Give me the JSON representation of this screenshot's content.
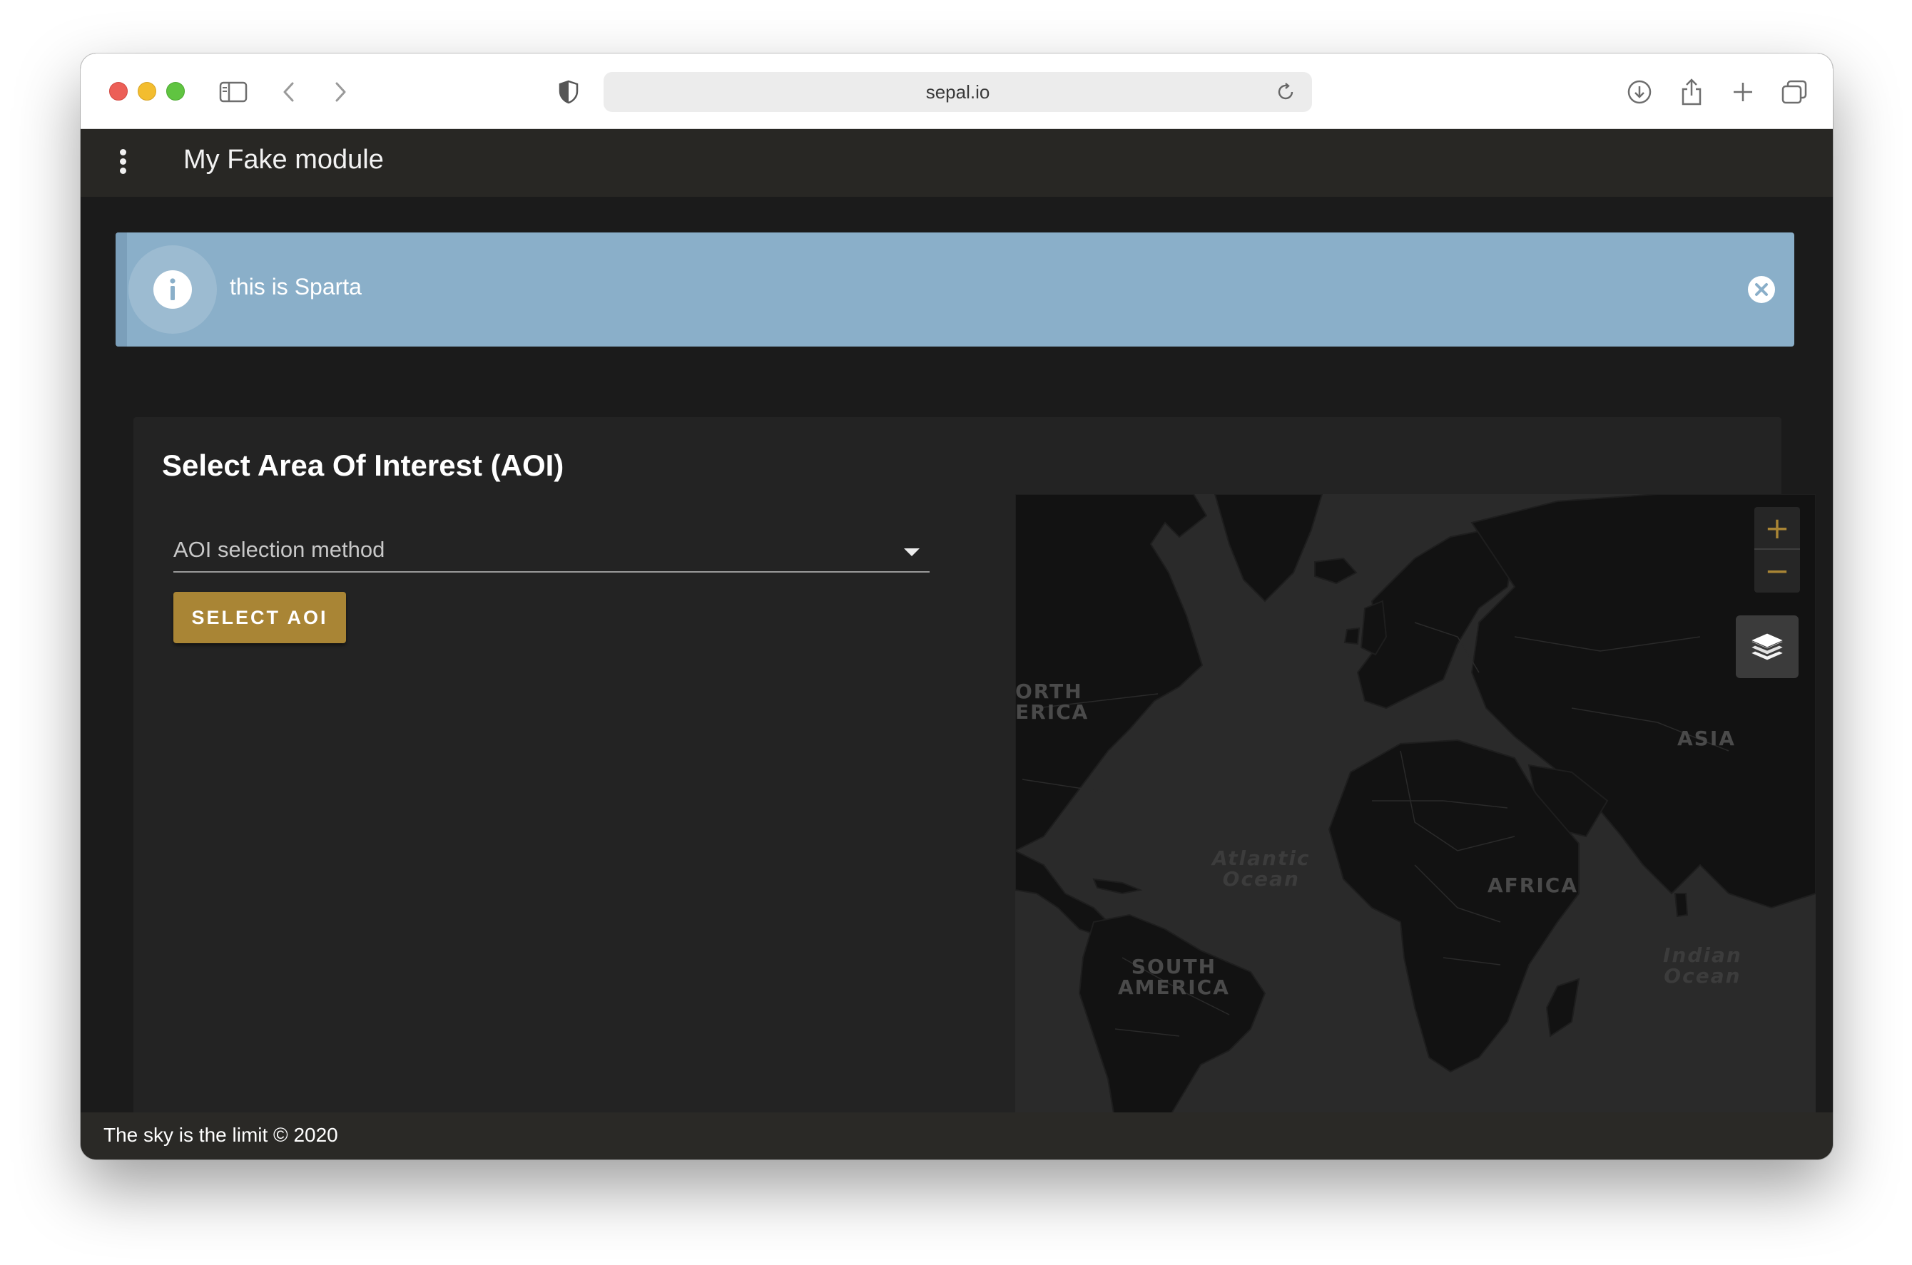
{
  "browser": {
    "url": "sepal.io",
    "icons": [
      "sidebar-icon",
      "back-icon",
      "forward-icon",
      "shield-icon",
      "reload-icon",
      "download-icon",
      "share-icon",
      "new-tab-icon",
      "tabs-overview-icon"
    ]
  },
  "app": {
    "title": "My Fake module",
    "menu_icon": "more-vertical-icon"
  },
  "alert": {
    "text": "this is Sparta",
    "icon": "info-icon",
    "close_icon": "close-circle-icon",
    "color": "#8aafc9"
  },
  "aoi_card": {
    "title": "Select Area Of Interest (AOI)",
    "select_label": "AOI selection method",
    "select_button": "SELECT AOI",
    "accent_color": "#a98535"
  },
  "map": {
    "labels": {
      "north_america": "ORTH\nERICA",
      "asia": "ASIA",
      "africa": "AFRICA",
      "south_america": "SOUTH\nAMERICA",
      "atlantic": "Atlantic\nOcean",
      "indian": "Indian\nOcean"
    },
    "zoom_in": "+",
    "zoom_out": "−",
    "layers_icon": "layers-icon"
  },
  "footer": {
    "text": "The sky is the limit © 2020"
  }
}
